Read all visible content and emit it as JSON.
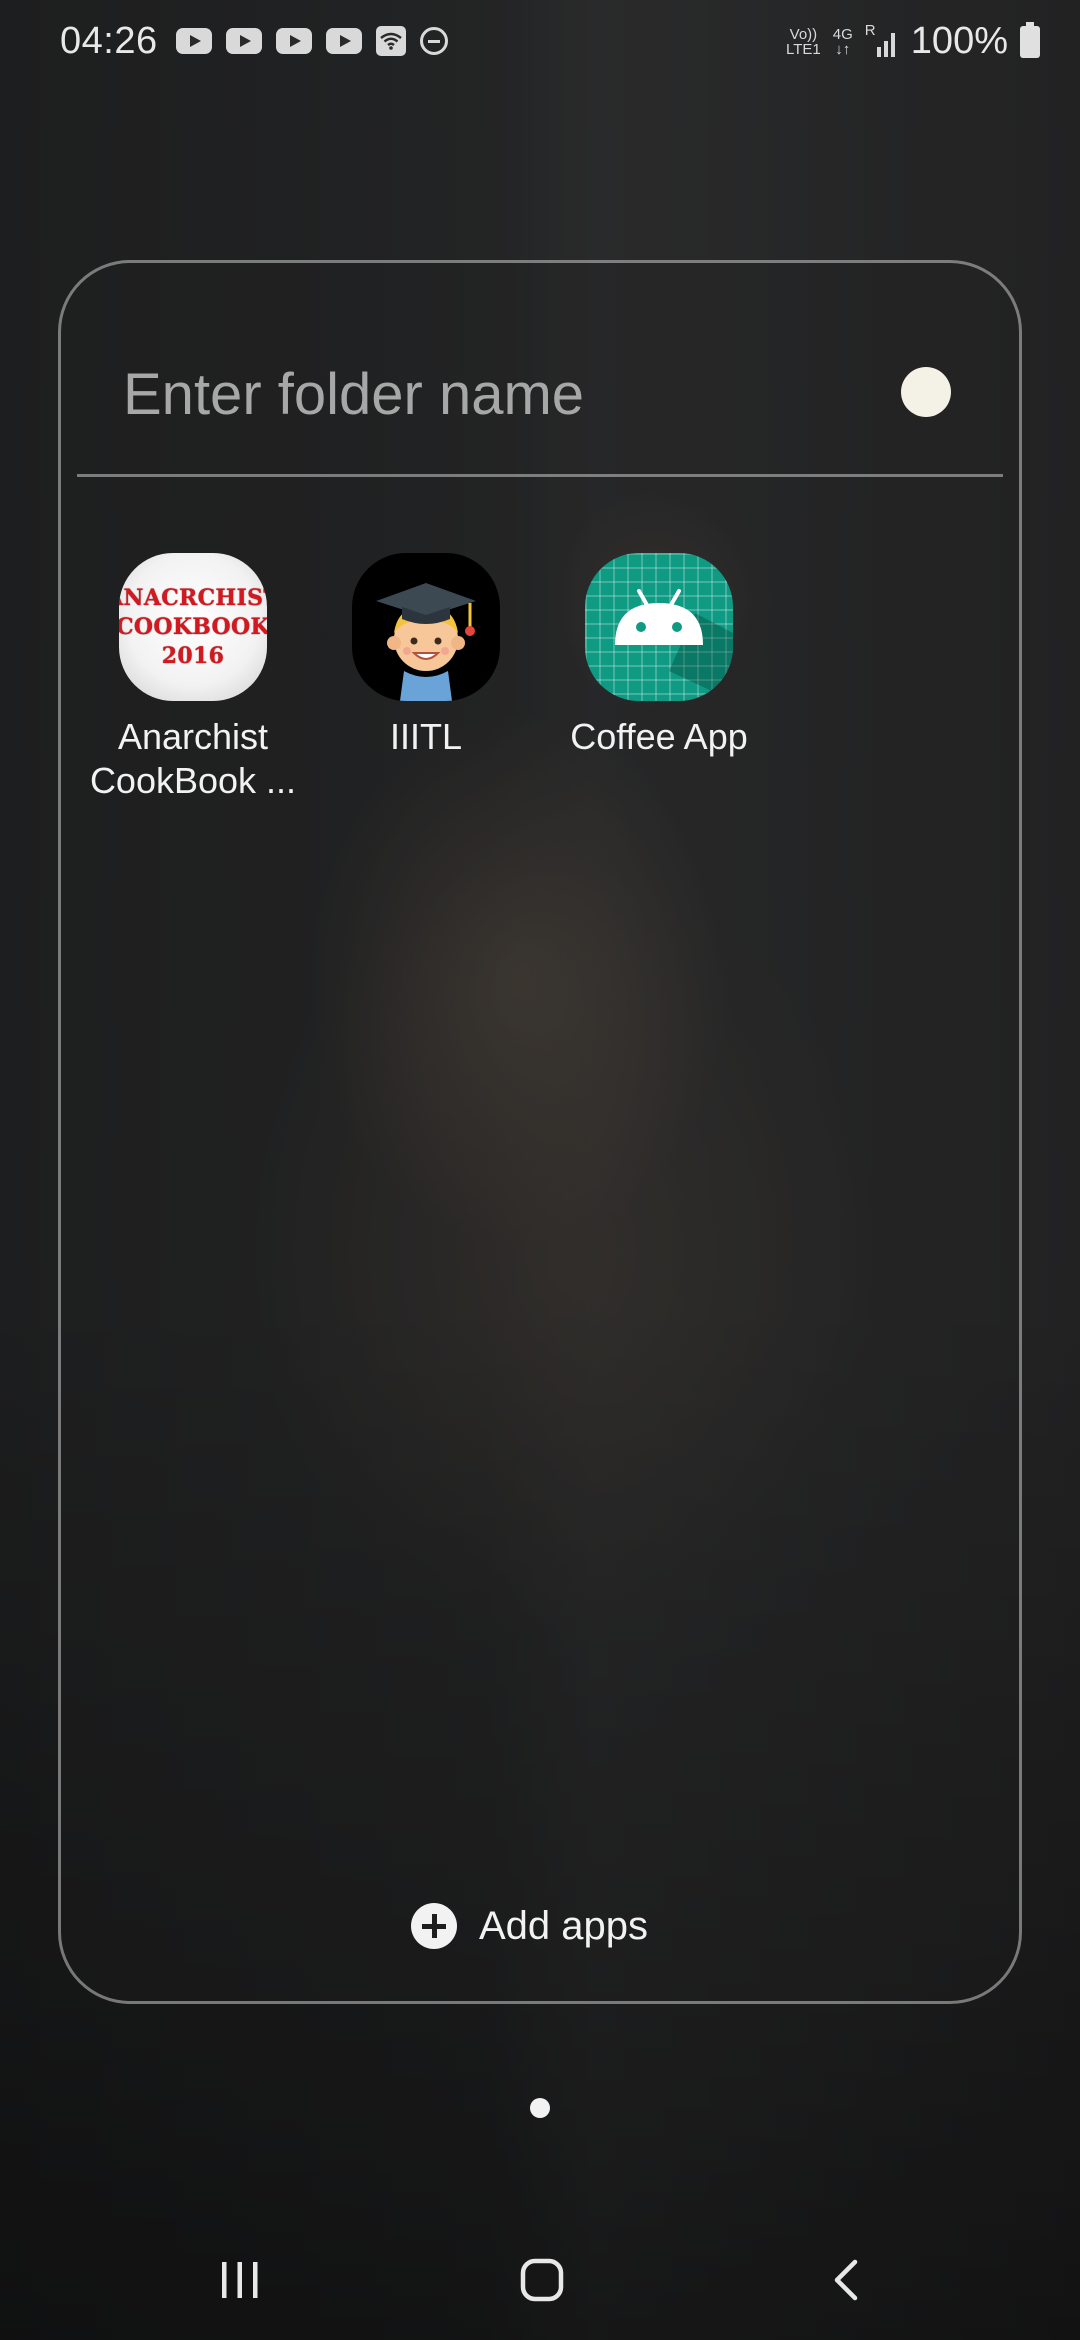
{
  "status_bar": {
    "time": "04:26",
    "notification_icons": [
      "youtube-icon",
      "youtube-icon",
      "youtube-icon",
      "youtube-icon",
      "wifi-calling-icon",
      "do-not-disturb-icon"
    ],
    "volte_label_top": "Vo))",
    "volte_label_bottom": "LTE1",
    "network_type": "4G",
    "roaming_label": "R",
    "battery_percent": "100%"
  },
  "folder": {
    "name_placeholder": "Enter folder name",
    "color_swatch": "#f4f1e6",
    "apps": [
      {
        "label_line1": "Anarchist",
        "label_line2": "CookBook ...",
        "icon_text": [
          "ANACRCHIST",
          "COOKBOOK",
          "2016"
        ]
      },
      {
        "label_line1": "IIITL",
        "label_line2": ""
      },
      {
        "label_line1": "Coffee App",
        "label_line2": ""
      }
    ],
    "add_apps_label": "Add apps"
  },
  "navigation": {
    "buttons": [
      "recents-icon",
      "home-icon",
      "back-icon"
    ]
  },
  "colors": {
    "text_primary": "#f2f2f2",
    "placeholder": "#a7a7a7",
    "coffee_icon_bg": "#0f9a83"
  }
}
